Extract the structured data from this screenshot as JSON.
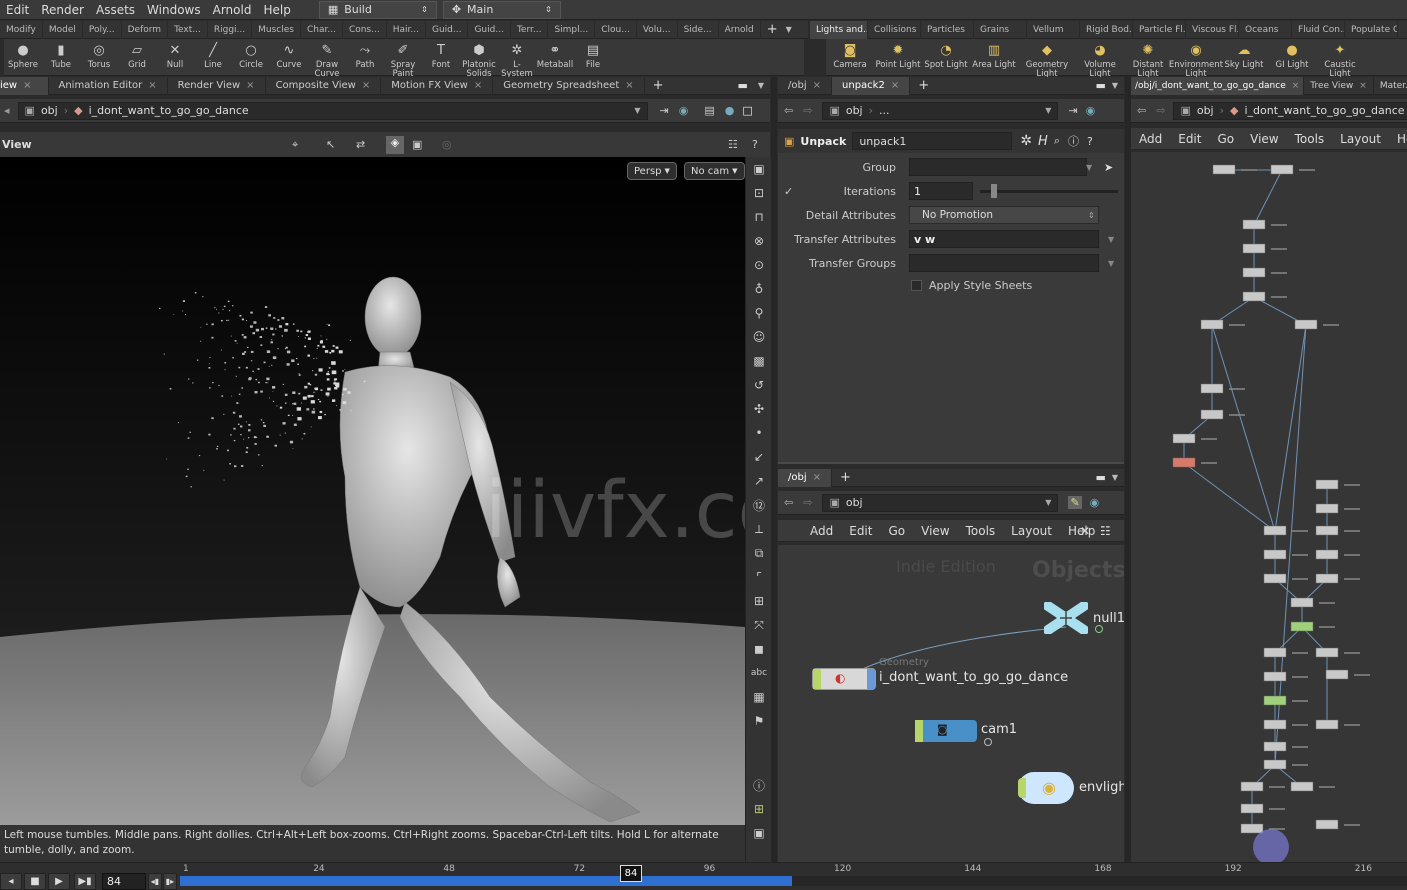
{
  "menubar": {
    "items": [
      "Edit",
      "Render",
      "Assets",
      "Windows",
      "Arnold",
      "Help"
    ],
    "desktop": "Build",
    "network": "Main"
  },
  "shelf_left": {
    "tabs": [
      "Modify",
      "Model",
      "Poly...",
      "Deform",
      "Text...",
      "Riggi...",
      "Muscles",
      "Char...",
      "Cons...",
      "Hair...",
      "Guid...",
      "Guid...",
      "Terr...",
      "Simpl...",
      "Clou...",
      "Volu...",
      "Side...",
      "Arnold"
    ],
    "tools": [
      {
        "label": "Sphere",
        "icon": "sphere-icon"
      },
      {
        "label": "Tube",
        "icon": "tube-icon"
      },
      {
        "label": "Torus",
        "icon": "torus-icon"
      },
      {
        "label": "Grid",
        "icon": "grid-icon"
      },
      {
        "label": "Null",
        "icon": "null-icon"
      },
      {
        "label": "Line",
        "icon": "line-icon"
      },
      {
        "label": "Circle",
        "icon": "circle-icon"
      },
      {
        "label": "Curve",
        "icon": "curve-icon"
      },
      {
        "label": "Draw Curve",
        "icon": "draw-curve-icon"
      },
      {
        "label": "Path",
        "icon": "path-icon"
      },
      {
        "label": "Spray Paint",
        "icon": "spray-paint-icon"
      },
      {
        "label": "Font",
        "icon": "font-icon"
      },
      {
        "label": "Platonic Solids",
        "icon": "platonic-icon"
      },
      {
        "label": "L-System",
        "icon": "lsystem-icon"
      },
      {
        "label": "Metaball",
        "icon": "metaball-icon"
      },
      {
        "label": "File",
        "icon": "file-icon"
      }
    ]
  },
  "shelf_right": {
    "tabs": [
      "Lights and...",
      "Collisions",
      "Particles",
      "Grains",
      "Vellum",
      "Rigid Bod...",
      "Particle Fl...",
      "Viscous Fl...",
      "Oceans",
      "Fluid Con...",
      "Populate C..."
    ],
    "tools": [
      {
        "label": "Camera",
        "icon": "camera-icon"
      },
      {
        "label": "Point Light",
        "icon": "point-light-icon"
      },
      {
        "label": "Spot Light",
        "icon": "spot-light-icon"
      },
      {
        "label": "Area Light",
        "icon": "area-light-icon"
      },
      {
        "label": "Geometry Light",
        "icon": "geometry-light-icon"
      },
      {
        "label": "Volume Light",
        "icon": "volume-light-icon"
      },
      {
        "label": "Distant Light",
        "icon": "distant-light-icon"
      },
      {
        "label": "Environment Light",
        "icon": "environment-light-icon"
      },
      {
        "label": "Sky Light",
        "icon": "sky-light-icon"
      },
      {
        "label": "GI Light",
        "icon": "gi-light-icon"
      },
      {
        "label": "Caustic Light",
        "icon": "caustic-light-icon"
      }
    ]
  },
  "left_pane": {
    "tabs": [
      "iew",
      "Animation Editor",
      "Render View",
      "Composite View",
      "Motion FX View",
      "Geometry Spreadsheet"
    ],
    "path_root": "obj",
    "path_node": "i_dont_want_to_go_go_dance",
    "view_title": "View",
    "persp": "Persp",
    "cam": "No cam",
    "watermark": "iiivfx.com",
    "status": "Left mouse tumbles. Middle pans. Right dollies. Ctrl+Alt+Left box-zooms. Ctrl+Right zooms. Spacebar-Ctrl-Left tilts. Hold L for alternate tumble, dolly, and zoom."
  },
  "param_pane": {
    "tabs": [
      "/obj",
      "unpack2"
    ],
    "path_root": "obj",
    "path_node": "...",
    "node_type": "Unpack",
    "node_name": "unpack1",
    "rows": [
      {
        "label": "Group",
        "value": ""
      },
      {
        "label": "Iterations",
        "value": "1"
      },
      {
        "label": "Detail Attributes",
        "value": "No Promotion"
      },
      {
        "label": "Transfer Attributes",
        "value": "v w"
      },
      {
        "label": "Transfer Groups",
        "value": ""
      }
    ],
    "checkbox_label": "Apply Style Sheets"
  },
  "obj_network": {
    "tab": "/obj",
    "path": "obj",
    "menu": [
      "Add",
      "Edit",
      "Go",
      "View",
      "Tools",
      "Layout",
      "Help"
    ],
    "edition": "Indie Edition",
    "context": "Objects",
    "nodes": {
      "null": "null1",
      "geo_type": "Geometry",
      "geo": "i_dont_want_to_go_go_dance",
      "cam": "cam1",
      "light": "envlight"
    }
  },
  "right_network": {
    "tabs": [
      "/obj/i_dont_want_to_go_go_dance",
      "Tree View",
      "Mater..."
    ],
    "path_root": "obj",
    "path_node": "i_dont_want_to_go_go_dance",
    "menu": [
      "Add",
      "Edit",
      "Go",
      "View",
      "Tools",
      "Layout",
      "Help"
    ]
  },
  "timeline": {
    "current_frame": "84",
    "marker": "84",
    "ticks": [
      "1",
      "24",
      "48",
      "72",
      "96",
      "120",
      "144",
      "168",
      "192",
      "216"
    ],
    "progress": 0.58
  }
}
